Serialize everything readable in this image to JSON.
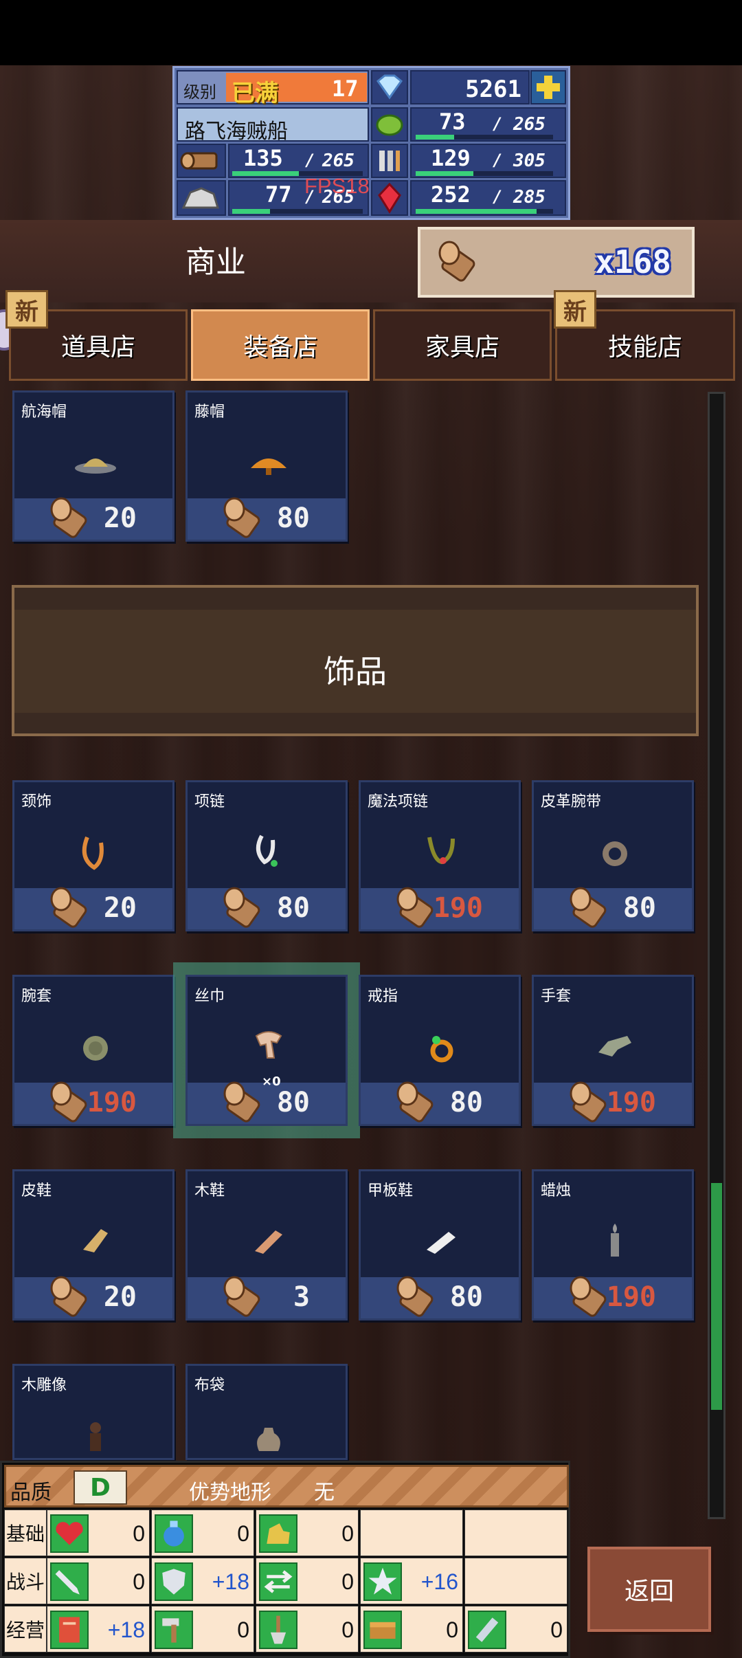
{
  "status": {
    "level_label": "级别",
    "level_max": "已满",
    "level_value": "17",
    "gems": "5261",
    "ship_name": "路飞海贼船",
    "food": "73",
    "food_max": "265",
    "food_fill": 0.28,
    "wood": "135",
    "wood_max": "265",
    "wood_fill": 0.51,
    "tools": "129",
    "tools_max": "305",
    "tools_fill": 0.42,
    "ore": "77",
    "ore_max": "265",
    "ore_fill": 0.29,
    "gems2": "252",
    "gems2_max": "285",
    "gems2_fill": 0.88
  },
  "fps": "FPS18",
  "category": "商业",
  "wood_counter": "x168",
  "tabs": [
    {
      "label": "道具店",
      "new": "新"
    },
    {
      "label": "装备店",
      "new": ""
    },
    {
      "label": "家具店",
      "new": ""
    },
    {
      "label": "技能店",
      "new": "新"
    }
  ],
  "hats": [
    {
      "name": "航海帽",
      "price": "20"
    },
    {
      "name": "藤帽",
      "price": "80"
    }
  ],
  "section_title": "饰品",
  "accessories": [
    {
      "name": "颈饰",
      "price": "20",
      "red": false
    },
    {
      "name": "项链",
      "price": "80",
      "red": false
    },
    {
      "name": "魔法项链",
      "price": "190",
      "red": true
    },
    {
      "name": "皮革腕带",
      "price": "80",
      "red": false
    },
    {
      "name": "腕套",
      "price": "190",
      "red": true
    },
    {
      "name": "丝巾",
      "price": "80",
      "red": false,
      "qty": "×0"
    },
    {
      "name": "戒指",
      "price": "80",
      "red": false
    },
    {
      "name": "手套",
      "price": "190",
      "red": true
    },
    {
      "name": "皮鞋",
      "price": "20",
      "red": false
    },
    {
      "name": "木鞋",
      "price": "3",
      "red": false
    },
    {
      "name": "甲板鞋",
      "price": "80",
      "red": false
    },
    {
      "name": "蜡烛",
      "price": "190",
      "red": true
    },
    {
      "name": "木雕像",
      "price": "",
      "red": false
    },
    {
      "name": "布袋",
      "price": "",
      "red": false
    }
  ],
  "scroll_position": 0.88,
  "info": {
    "quality_label": "品质",
    "grade": "D",
    "terrain_label": "优势地形",
    "terrain_value": "无",
    "rows": [
      {
        "label": "基础",
        "values": [
          "0",
          "0",
          "0"
        ]
      },
      {
        "label": "战斗",
        "values": [
          "0",
          "+18",
          "0",
          "+16"
        ]
      },
      {
        "label": "经营",
        "values": [
          "+18",
          "0",
          "0",
          "0",
          "0"
        ]
      }
    ]
  },
  "back_label": "返回",
  "colors": {
    "accent_tab": "#d2894f",
    "card_bg": "#18213f",
    "price_red": "#d85840",
    "stat_green": "#2fae4a"
  }
}
